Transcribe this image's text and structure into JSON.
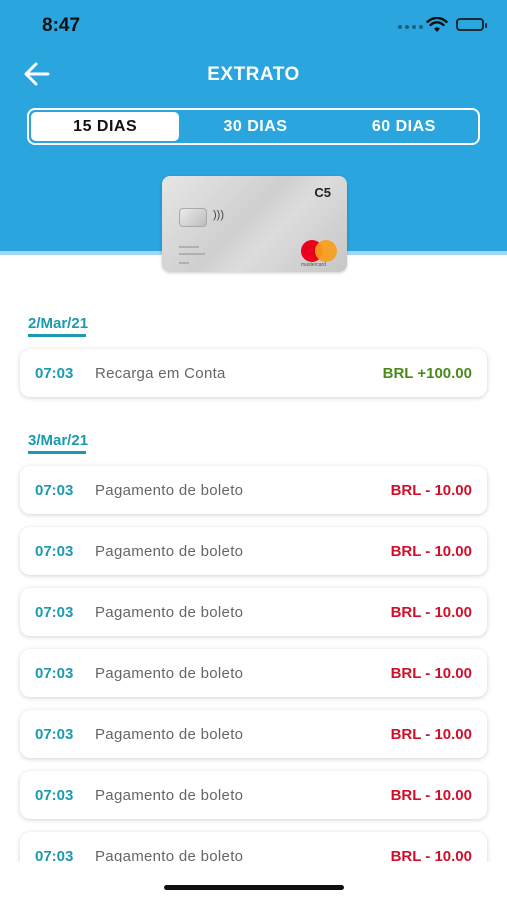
{
  "status": {
    "time": "8:47"
  },
  "header": {
    "title": "EXTRATO"
  },
  "tabs": [
    {
      "label": "15 DIAS",
      "active": true
    },
    {
      "label": "30 DIAS",
      "active": false
    },
    {
      "label": "60 DIAS",
      "active": false
    }
  ],
  "card": {
    "brand_label": "C5",
    "network": "mastercard"
  },
  "groups": [
    {
      "date": "2/Mar/21",
      "items": [
        {
          "time": "07:03",
          "desc": "Recarga em Conta",
          "amount": "BRL +100.00",
          "type": "credit"
        }
      ]
    },
    {
      "date": "3/Mar/21",
      "items": [
        {
          "time": "07:03",
          "desc": "Pagamento de boleto",
          "amount": "BRL - 10.00",
          "type": "debit"
        },
        {
          "time": "07:03",
          "desc": "Pagamento de boleto",
          "amount": "BRL - 10.00",
          "type": "debit"
        },
        {
          "time": "07:03",
          "desc": "Pagamento de boleto",
          "amount": "BRL - 10.00",
          "type": "debit"
        },
        {
          "time": "07:03",
          "desc": "Pagamento de boleto",
          "amount": "BRL - 10.00",
          "type": "debit"
        },
        {
          "time": "07:03",
          "desc": "Pagamento de boleto",
          "amount": "BRL - 10.00",
          "type": "debit"
        },
        {
          "time": "07:03",
          "desc": "Pagamento de boleto",
          "amount": "BRL - 10.00",
          "type": "debit"
        },
        {
          "time": "07:03",
          "desc": "Pagamento de boleto",
          "amount": "BRL - 10.00",
          "type": "debit"
        }
      ]
    }
  ],
  "colors": {
    "header": "#2aa5de",
    "accent": "#1b9ab1",
    "credit": "#4a8a1a",
    "debit": "#d0102a"
  }
}
